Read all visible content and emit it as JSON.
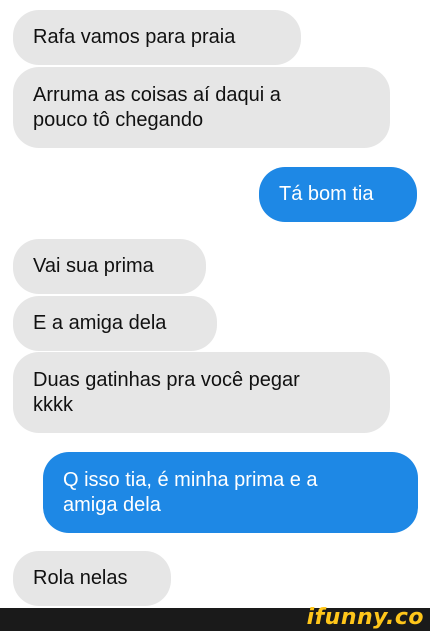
{
  "messages": [
    {
      "from": "received",
      "lines": [
        "Rafa vamos para praia"
      ]
    },
    {
      "from": "received",
      "lines": [
        "Arruma as coisas aí daqui a",
        "pouco tô chegando"
      ]
    },
    {
      "from": "sent",
      "lines": [
        "Tá bom tia"
      ]
    },
    {
      "from": "received",
      "lines": [
        "Vai sua prima"
      ]
    },
    {
      "from": "received",
      "lines": [
        "E a amiga dela"
      ]
    },
    {
      "from": "received",
      "lines": [
        "Duas gatinhas pra você pegar",
        "kkkk"
      ]
    },
    {
      "from": "sent",
      "lines": [
        "Q isso tia, é minha prima e a",
        "amiga dela"
      ]
    },
    {
      "from": "received",
      "lines": [
        "Rola nelas"
      ]
    }
  ],
  "watermark": "ifunny.co",
  "colors": {
    "received_bubble": "#e6e6e6",
    "sent_bubble": "#1e88e5",
    "footer": "#1a1a1a",
    "watermark": "#ffc61a"
  }
}
